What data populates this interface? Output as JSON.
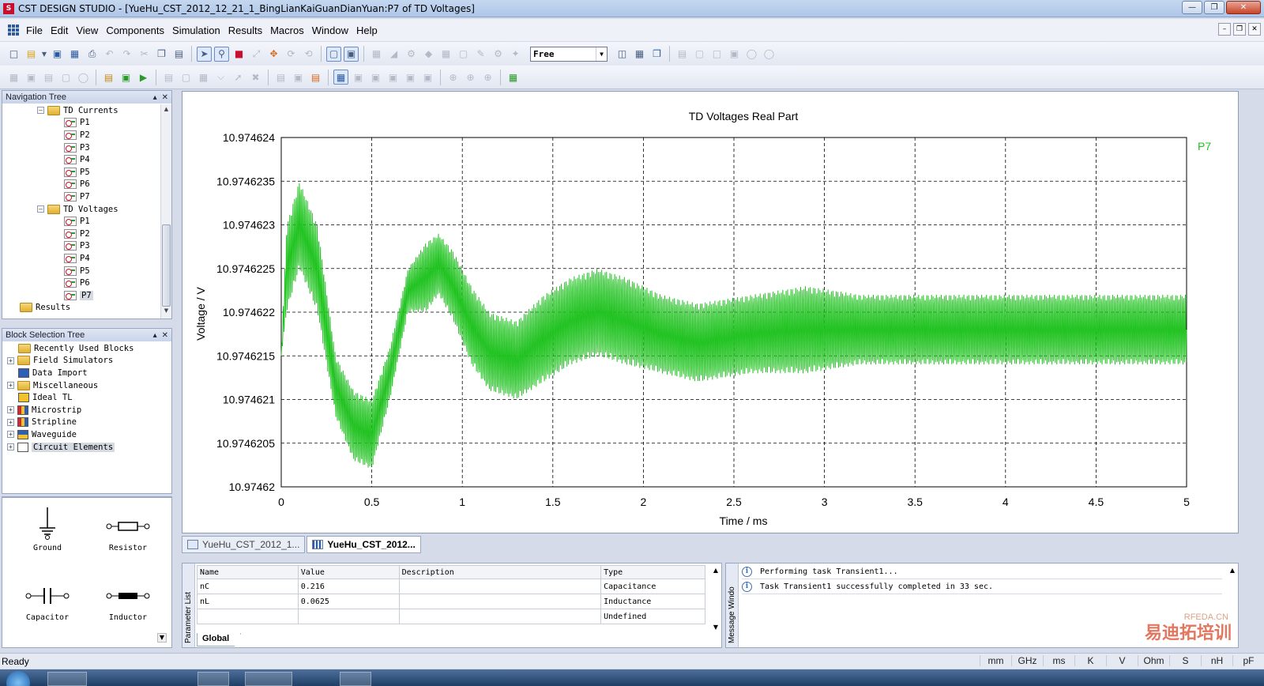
{
  "window": {
    "app_name": "CST DESIGN STUDIO",
    "title": "CST DESIGN STUDIO - [YueHu_CST_2012_12_21_1_BingLianKaiGuanDianYuan:P7 of TD Voltages]"
  },
  "menu": [
    "File",
    "Edit",
    "View",
    "Components",
    "Simulation",
    "Results",
    "Macros",
    "Window",
    "Help"
  ],
  "toolbar": {
    "mode_select": "Free"
  },
  "nav_tree": {
    "header": "Navigation Tree",
    "currents_label": "TD Currents",
    "currents": [
      "P1",
      "P2",
      "P3",
      "P4",
      "P5",
      "P6",
      "P7"
    ],
    "voltages_label": "TD Voltages",
    "voltages": [
      "P1",
      "P2",
      "P3",
      "P4",
      "P5",
      "P6",
      "P7"
    ],
    "results_label": "Results"
  },
  "block_tree": {
    "header": "Block Selection Tree",
    "items": [
      "Recently Used Blocks",
      "Field Simulators",
      "Data Import",
      "Miscellaneous",
      "Ideal TL",
      "Microstrip",
      "Stripline",
      "Waveguide",
      "Circuit Elements"
    ]
  },
  "palette": [
    "Ground",
    "Resistor",
    "Capacitor",
    "Inductor"
  ],
  "chart_data": {
    "type": "line",
    "title": "TD Voltages Real Part",
    "xlabel": "Time / ms",
    "ylabel": "Voltage / V",
    "xlim": [
      0,
      5
    ],
    "ylim": [
      10.97462,
      10.974624
    ],
    "x_ticks": [
      "0",
      "0.5",
      "1",
      "1.5",
      "2",
      "2.5",
      "3",
      "3.5",
      "4",
      "4.5",
      "5"
    ],
    "y_ticks": [
      "10.97462",
      "10.9746205",
      "10.974621",
      "10.9746215",
      "10.974622",
      "10.9746225",
      "10.974623",
      "10.9746235",
      "10.974624"
    ],
    "grid": true,
    "legend_position": "top-right",
    "series": [
      {
        "name": "P7",
        "color": "#1fc21f",
        "envelope_x": [
          0,
          0.03,
          0.1,
          0.2,
          0.3,
          0.4,
          0.5,
          0.6,
          0.7,
          0.8,
          0.87,
          0.95,
          1.05,
          1.15,
          1.3,
          1.45,
          1.6,
          1.75,
          1.9,
          2.1,
          2.3,
          2.6,
          2.9,
          3.2,
          3.5,
          4.0,
          4.5,
          5.0
        ],
        "envelope_upper": [
          10.9746215,
          10.974623,
          10.9746235,
          10.974623,
          10.9746215,
          10.9746211,
          10.974621,
          10.9746216,
          10.9746225,
          10.9746228,
          10.9746229,
          10.9746227,
          10.9746223,
          10.974622,
          10.9746219,
          10.9746222,
          10.9746224,
          10.9746225,
          10.9746224,
          10.9746222,
          10.9746221,
          10.9746222,
          10.9746223,
          10.9746222,
          10.9746222,
          10.9746222,
          10.9746222,
          10.9746222
        ],
        "envelope_lower": [
          10.9746215,
          10.974622,
          10.9746225,
          10.974622,
          10.9746208,
          10.9746203,
          10.9746202,
          10.974621,
          10.974622,
          10.974622,
          10.9746222,
          10.9746219,
          10.9746214,
          10.9746211,
          10.974621,
          10.9746212,
          10.9746214,
          10.9746215,
          10.9746214,
          10.9746213,
          10.9746212,
          10.9746213,
          10.9746213,
          10.9746214,
          10.9746214,
          10.9746214,
          10.9746214,
          10.9746214
        ]
      }
    ]
  },
  "doc_tabs": [
    "YueHu_CST_2012_1...",
    "YueHu_CST_2012..."
  ],
  "param_list": {
    "label": "Parameter List",
    "columns": [
      "Name",
      "Value",
      "Description",
      "Type"
    ],
    "rows": [
      [
        "nC",
        "0.216",
        "",
        "Capacitance"
      ],
      [
        "nL",
        "0.0625",
        "",
        "Inductance"
      ],
      [
        "",
        "",
        "",
        "Undefined"
      ]
    ],
    "tab": "Global"
  },
  "messages": {
    "label": "Message Windo",
    "items": [
      "Performing task Transient1...",
      "Task Transient1 successfully completed in 33 sec."
    ]
  },
  "watermark": {
    "brand": "易迪拓培训",
    "site": "RFEDA.CN"
  },
  "statusbar": {
    "status": "Ready",
    "units": [
      "mm",
      "GHz",
      "ms",
      "K",
      "V",
      "Ohm",
      "S",
      "nH",
      "pF"
    ]
  }
}
